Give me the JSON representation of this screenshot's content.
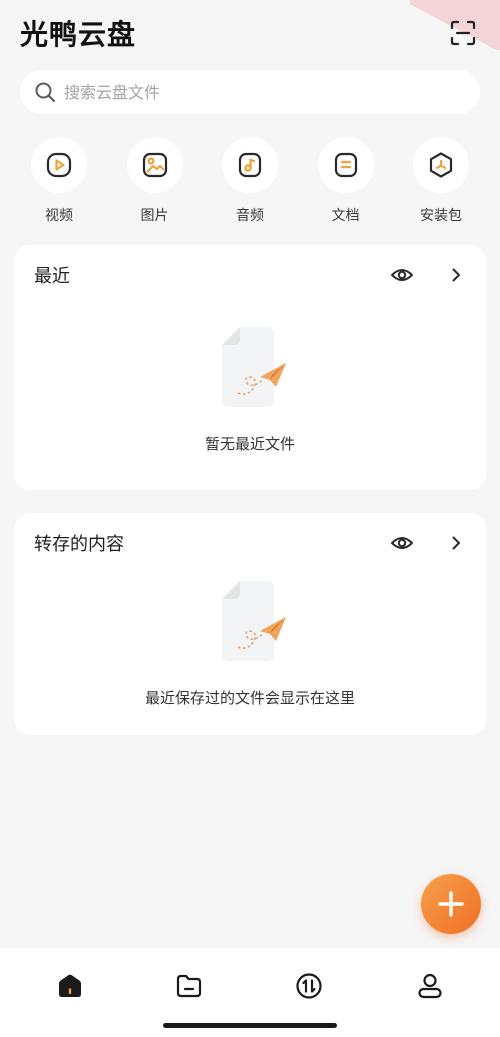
{
  "header": {
    "title": "光鸭云盘",
    "scan_icon": "scan-icon"
  },
  "search": {
    "placeholder": "搜索云盘文件",
    "value": ""
  },
  "categories": [
    {
      "label": "视频",
      "icon": "video-icon"
    },
    {
      "label": "图片",
      "icon": "image-icon"
    },
    {
      "label": "音频",
      "icon": "audio-icon"
    },
    {
      "label": "文档",
      "icon": "document-icon"
    },
    {
      "label": "安装包",
      "icon": "package-icon"
    }
  ],
  "recent": {
    "title": "最近",
    "empty_text": "暂无最近文件"
  },
  "saved": {
    "title": "转存的内容",
    "empty_text": "最近保存过的文件会显示在这里"
  },
  "bottom_nav": [
    {
      "icon": "home-icon",
      "active": true
    },
    {
      "icon": "folder-icon",
      "active": false
    },
    {
      "icon": "transfer-icon",
      "active": false
    },
    {
      "icon": "profile-icon",
      "active": false
    }
  ],
  "colors": {
    "accent": "#ef6f26",
    "accent_light": "#f7a04b",
    "background": "#f6f6f7",
    "card": "#ffffff",
    "icon_outline": "#2a2a2a",
    "icon_accent": "#f0a23a"
  }
}
